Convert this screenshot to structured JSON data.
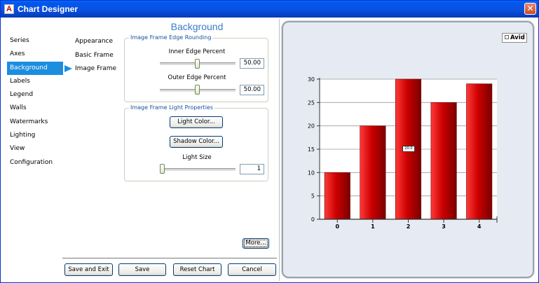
{
  "window": {
    "title": "Chart Designer",
    "app_icon_letter": "A",
    "close_glyph": "✕"
  },
  "nav": {
    "items": [
      {
        "label": "Series"
      },
      {
        "label": "Axes"
      },
      {
        "label": "Background",
        "selected": true
      },
      {
        "label": "Labels"
      },
      {
        "label": "Legend"
      },
      {
        "label": "Walls"
      },
      {
        "label": "Watermarks"
      },
      {
        "label": "Lighting"
      },
      {
        "label": "View"
      },
      {
        "label": "Configuration"
      }
    ]
  },
  "subnav": {
    "items": [
      {
        "label": "Appearance"
      },
      {
        "label": "Basic Frame"
      },
      {
        "label": "Image Frame",
        "selected": true
      }
    ]
  },
  "panel": {
    "title": "Background",
    "rounding_group": {
      "legend": "Image Frame Edge Rounding",
      "inner_label": "Inner Edge Percent",
      "inner_value": "50.00",
      "outer_label": "Outer Edge Percent",
      "outer_value": "50.00"
    },
    "light_group": {
      "legend": "Image Frame Light Properties",
      "light_color_button": "Light Color...",
      "shadow_color_button": "Shadow Color...",
      "light_size_label": "Light Size",
      "light_size_value": "1"
    },
    "more_button": "More..."
  },
  "footer": {
    "save_exit": "Save and Exit",
    "save": "Save",
    "reset": "Reset Chart",
    "cancel": "Cancel"
  },
  "chart_data": {
    "type": "bar",
    "categories": [
      "0",
      "1",
      "2",
      "3",
      "4"
    ],
    "series": [
      {
        "name": "Avid",
        "values": [
          10,
          20,
          30,
          25,
          29
        ],
        "color": "#cc0000"
      }
    ],
    "yticks": [
      "0",
      "5",
      "10",
      "15",
      "20",
      "25",
      "30"
    ],
    "ylim": [
      0,
      30
    ],
    "grid": true,
    "legend_position": "top-right",
    "data_label": "20.0"
  },
  "colors": {
    "accent": "#1c8ee0",
    "title_blue": "#3a7cc6",
    "bar_red": "#cc0000",
    "chart_bg": "#e6ebf3"
  }
}
